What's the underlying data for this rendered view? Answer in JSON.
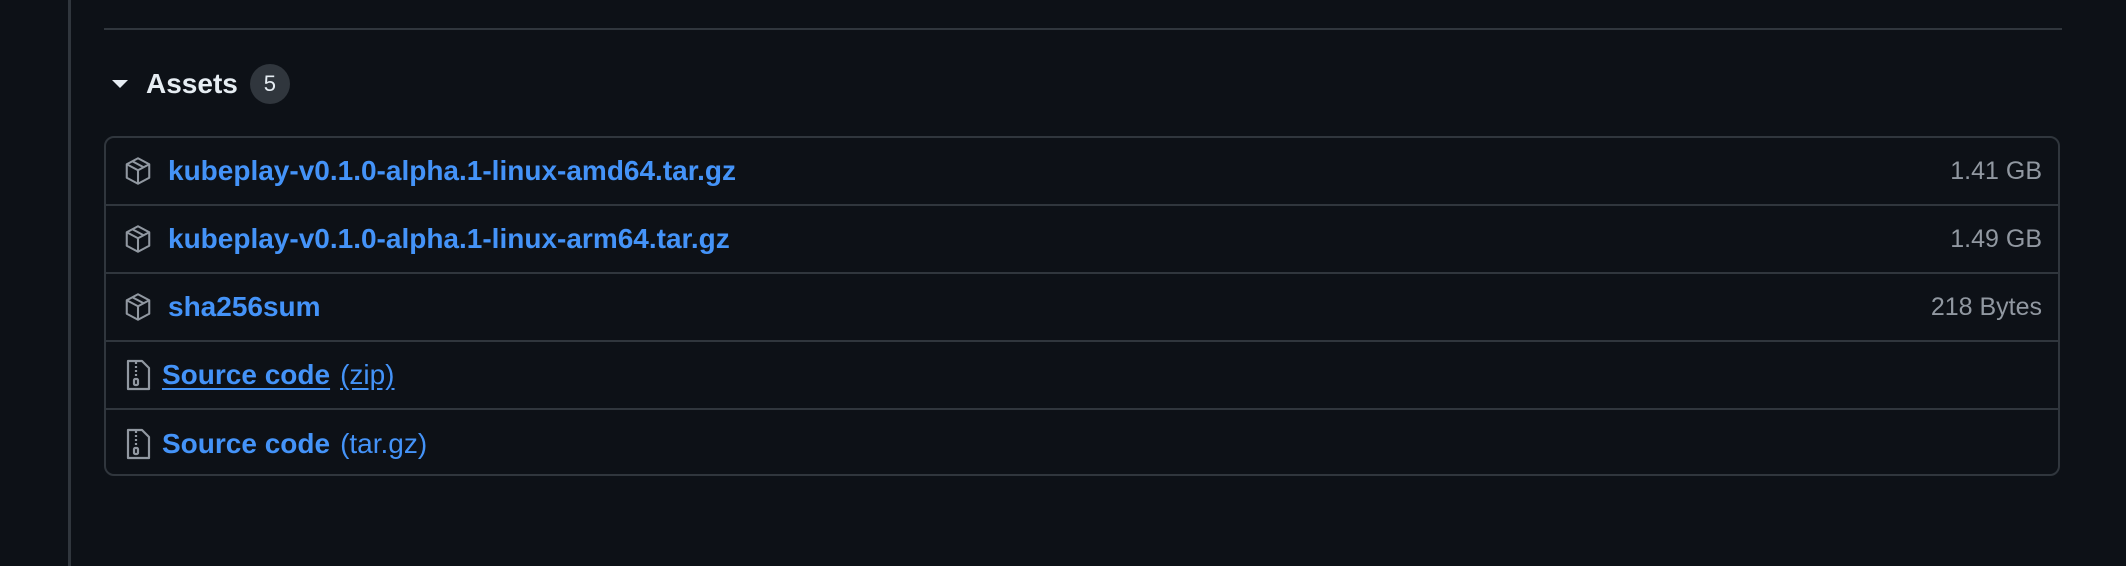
{
  "assets": {
    "title": "Assets",
    "count": "5",
    "files": [
      {
        "name": "kubeplay-v0.1.0-alpha.1-linux-amd64.tar.gz",
        "size": "1.41 GB",
        "icon": "package-icon"
      },
      {
        "name": "kubeplay-v0.1.0-alpha.1-linux-arm64.tar.gz",
        "size": "1.49 GB",
        "icon": "package-icon"
      },
      {
        "name": "sha256sum",
        "size": "218 Bytes",
        "icon": "package-icon"
      }
    ],
    "source_code": [
      {
        "label": "Source code",
        "format": "(zip)",
        "icon": "file-zip-icon"
      },
      {
        "label": "Source code",
        "format": "(tar.gz)",
        "icon": "file-zip-icon"
      }
    ]
  },
  "colors": {
    "background": "#0d1117",
    "border": "#30363d",
    "link": "#4493f8",
    "muted": "#9198a1",
    "text": "#e6edf3"
  }
}
